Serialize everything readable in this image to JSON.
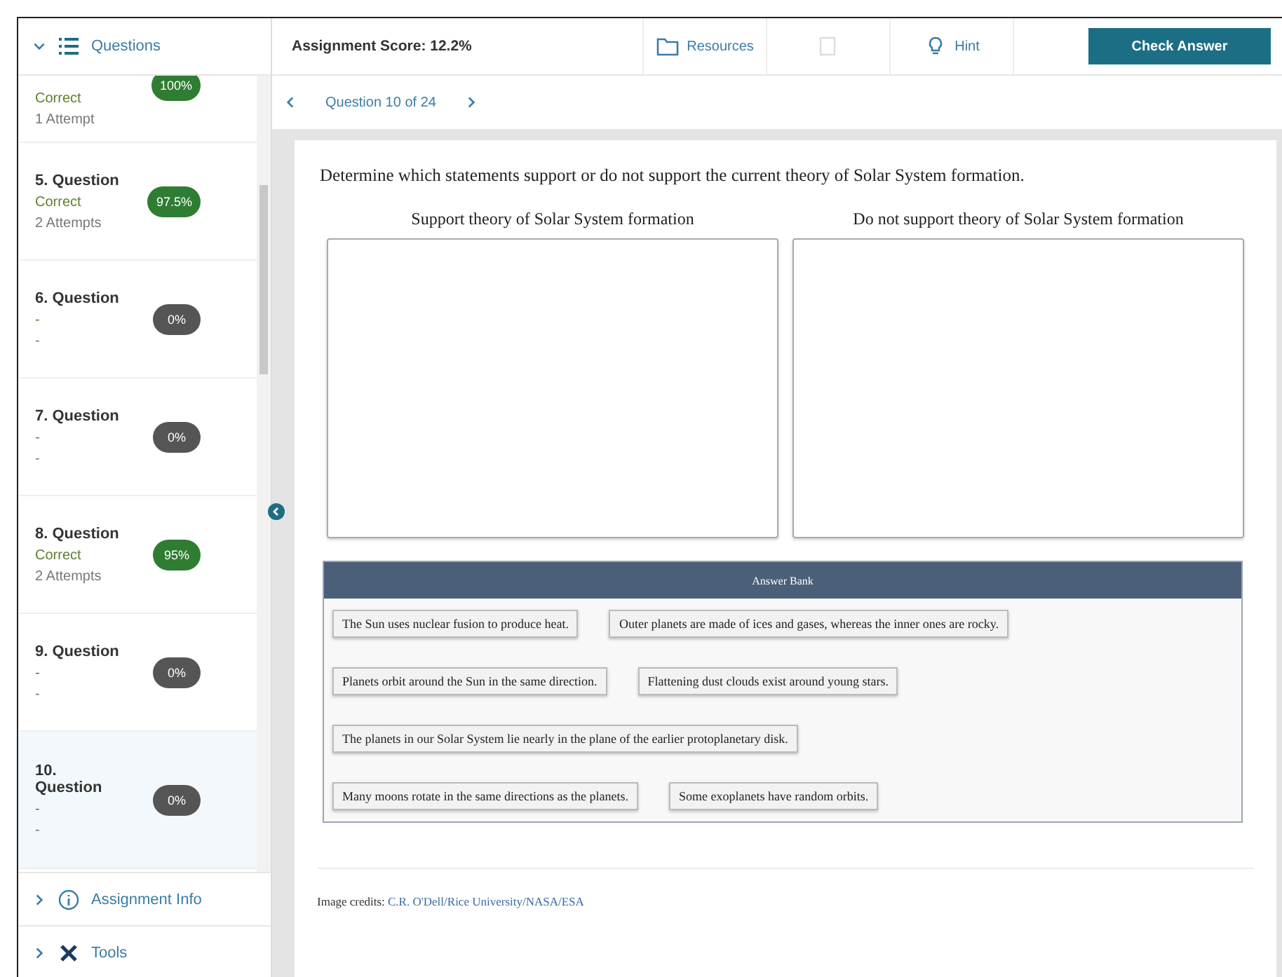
{
  "sidebar": {
    "header": "Questions",
    "expanded": true,
    "items": [
      {
        "status": "Correct",
        "attempts": "1 Attempt",
        "score": "100%",
        "color": "#2e7d32",
        "selected": false,
        "cut": true
      },
      {
        "title": "5. Question",
        "status": "Correct",
        "attempts": "2 Attempts",
        "score": "97.5%",
        "color": "#2e7d32",
        "selected": false
      },
      {
        "title": "6. Question",
        "status": "-",
        "attempts": "-",
        "score": "0%",
        "color": "#555555",
        "selected": false
      },
      {
        "title": "7. Question",
        "status": "-",
        "attempts": "-",
        "score": "0%",
        "color": "#555555",
        "selected": false
      },
      {
        "title": "8. Question",
        "status": "Correct",
        "attempts": "2 Attempts",
        "score": "95%",
        "color": "#2e7d32",
        "selected": false
      },
      {
        "title": "9. Question",
        "status": "-",
        "attempts": "-",
        "score": "0%",
        "color": "#555555",
        "selected": false
      },
      {
        "title": "10. Question",
        "status": "-",
        "attempts": "-",
        "score": "0%",
        "color": "#555555",
        "selected": true
      }
    ],
    "sections": [
      {
        "label": "Assignment Info",
        "kind": "info",
        "expanded": false
      },
      {
        "label": "Tools",
        "kind": "tools",
        "expanded": false
      }
    ]
  },
  "toolbar": {
    "score": "Assignment Score: 12.2%",
    "buttons": [
      {
        "kind": "folder",
        "label": "Resources",
        "disabled": false
      },
      {
        "kind": "blank",
        "disabled": true
      },
      {
        "kind": "bulb",
        "label": "Hint",
        "disabled": false
      }
    ],
    "primary": "Check Answer"
  },
  "nav": {
    "label": "Question 10 of 24"
  },
  "question": {
    "prompt": "Determine which statements support or do not support the current theory of Solar System formation.",
    "bins": [
      {
        "heading": "Support theory of Solar System formation"
      },
      {
        "heading": "Do not support theory of Solar System formation"
      }
    ],
    "answer_bank": {
      "title": "Answer Bank",
      "rows": [
        [
          "The Sun uses nuclear fusion to produce heat.",
          "Outer planets are made of ices and gases, whereas the inner ones are rocky."
        ],
        [
          "Planets orbit around the Sun in the same direction.",
          "Flattening dust clouds exist around young stars."
        ],
        [
          "The planets in our Solar System lie nearly in the plane of the earlier protoplanetary disk."
        ],
        [
          "Many moons rotate in the same directions as the planets.",
          "Some exoplanets have random orbits."
        ]
      ]
    }
  },
  "credits": {
    "label": "Image credits:",
    "link": "C.R. O'Dell/Rice University/NASA/ESA"
  }
}
